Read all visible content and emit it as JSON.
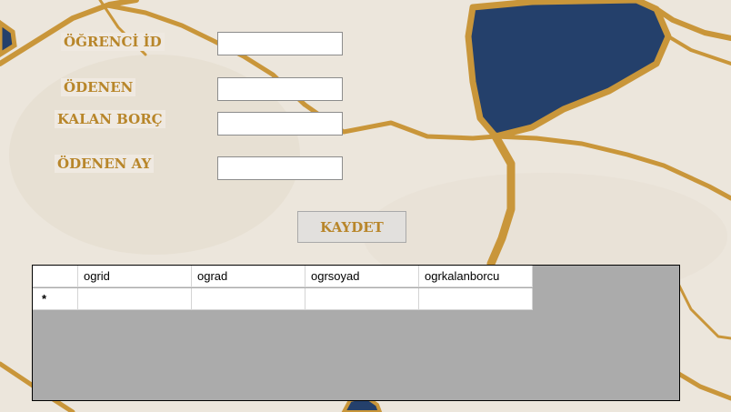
{
  "form": {
    "labels": {
      "student_id": "ÖĞRENCİ İD",
      "paid": "ÖDENEN",
      "remaining_debt": "KALAN BORÇ",
      "paid_month": "ÖDENEN AY"
    },
    "fields": {
      "student_id": "",
      "paid": "",
      "remaining_debt": "",
      "paid_month": ""
    },
    "save_label": "KAYDET"
  },
  "grid": {
    "columns": [
      "ogrid",
      "ograd",
      "ogrsoyad",
      "ogrkalanborcu"
    ],
    "new_row_marker": "*"
  },
  "colors": {
    "label_text": "#b8862a",
    "grid_background": "#ababab",
    "marble_navy": "#24406b",
    "marble_gold": "#c9963a"
  }
}
